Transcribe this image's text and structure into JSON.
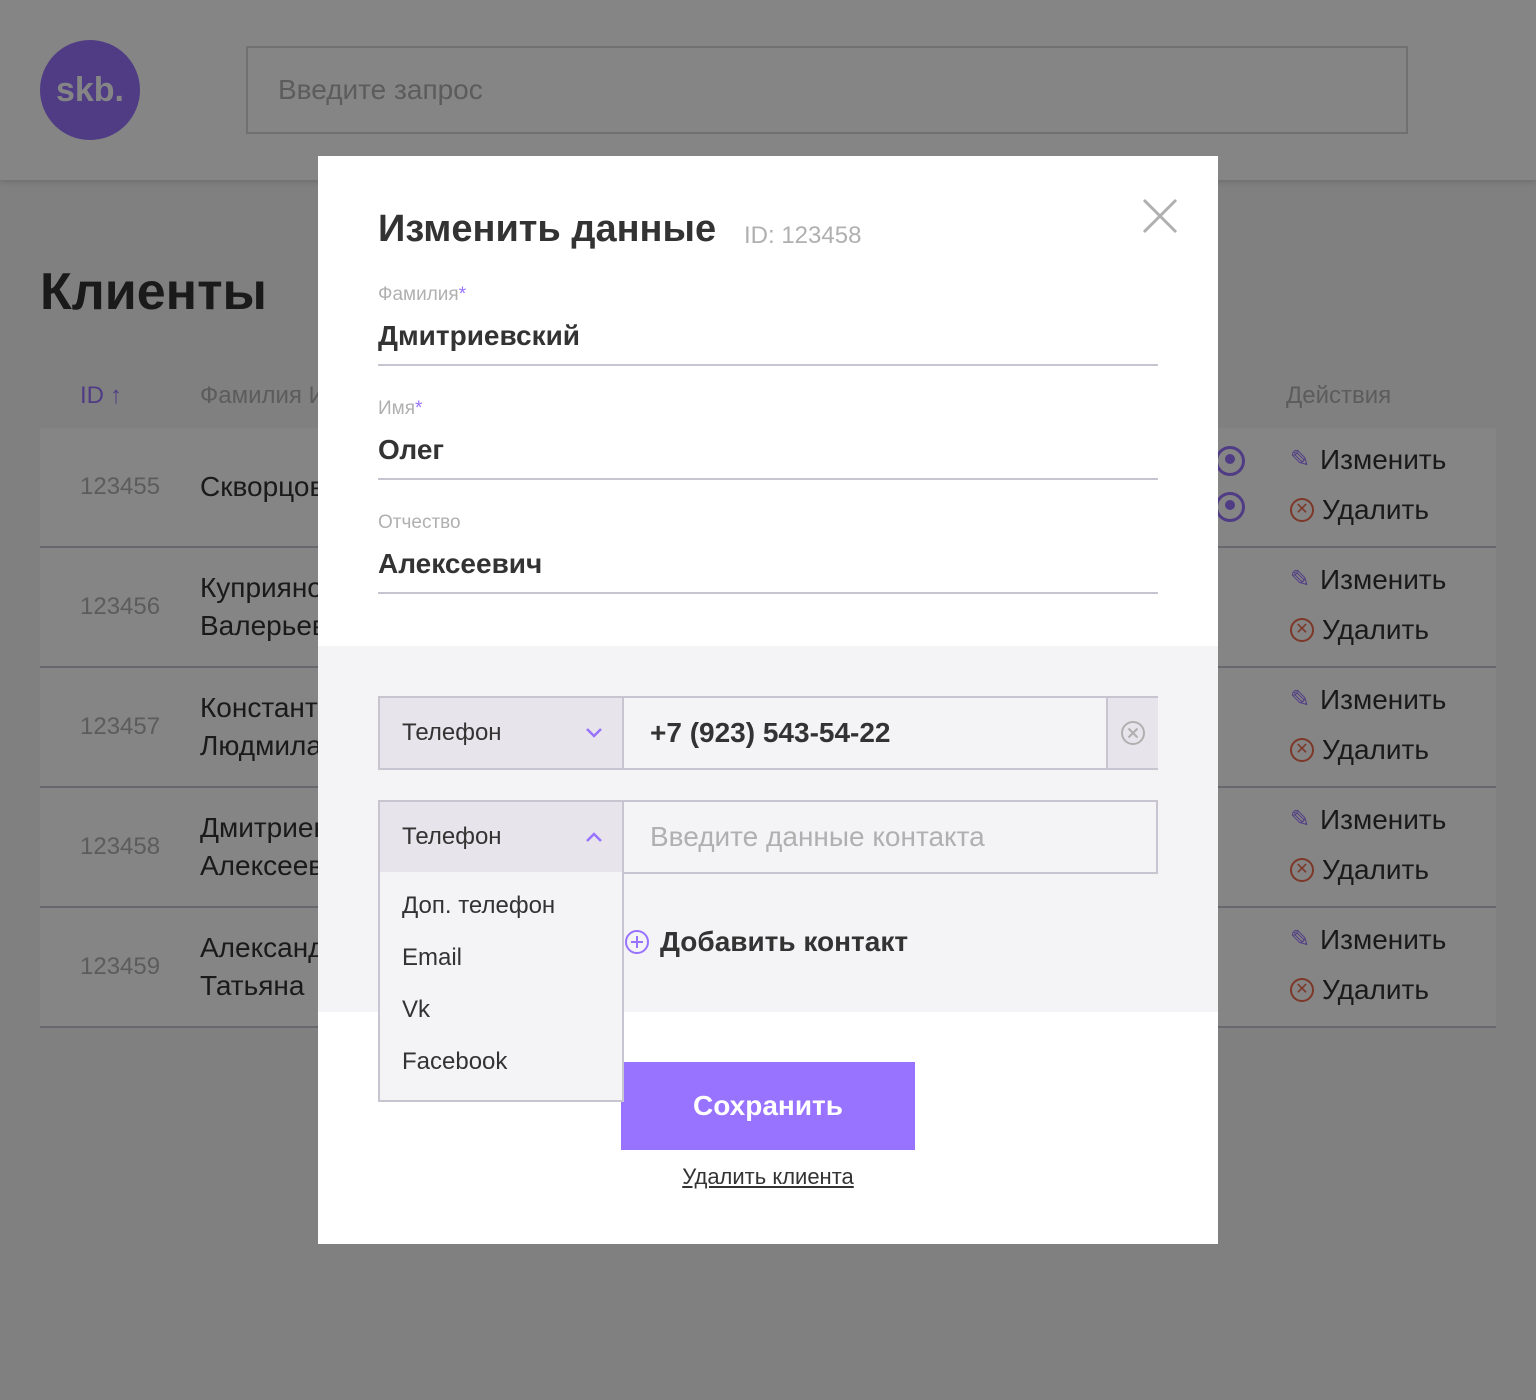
{
  "colors": {
    "accent": "#9873ff",
    "danger": "#f06a4d",
    "muted": "#b0b0b0",
    "border": "#c8c5d1"
  },
  "header": {
    "logo_text": "skb.",
    "search_placeholder": "Введите запрос"
  },
  "page": {
    "title": "Клиенты"
  },
  "table": {
    "columns": {
      "id": "ID",
      "fio": "Фамилия Имя Отчество",
      "actions": "Действия"
    },
    "edit_label": "Изменить",
    "delete_label": "Удалить",
    "rows": [
      {
        "id": "123455",
        "fio": "Скворцов"
      },
      {
        "id": "123456",
        "fio": "Куприянов\nВалерьевич"
      },
      {
        "id": "123457",
        "fio": "Константинопольская\nЛюдмила"
      },
      {
        "id": "123458",
        "fio": "Дмитриевский\nАлексеевич"
      },
      {
        "id": "123459",
        "fio": "Александрова\nТатьяна"
      }
    ]
  },
  "modal": {
    "title": "Изменить данные",
    "id_label": "ID: 123458",
    "fields": [
      {
        "label": "Фамилия",
        "required": "*",
        "value": "Дмитриевский"
      },
      {
        "label": "Имя",
        "required": "*",
        "value": "Олег"
      },
      {
        "label": "Отчество",
        "required": "",
        "value": "Алексеевич"
      }
    ],
    "contacts": [
      {
        "type": "Телефон",
        "value": "+7 (923) 543-54-22",
        "placeholder": ""
      },
      {
        "type": "Телефон",
        "value": "",
        "placeholder": "Введите данные контакта"
      }
    ],
    "dropdown_options": [
      "Доп. телефон",
      "Email",
      "Vk",
      "Facebook"
    ],
    "add_contact_label": "Добавить контакт",
    "save_label": "Сохранить",
    "delete_client_label": "Удалить клиента"
  }
}
